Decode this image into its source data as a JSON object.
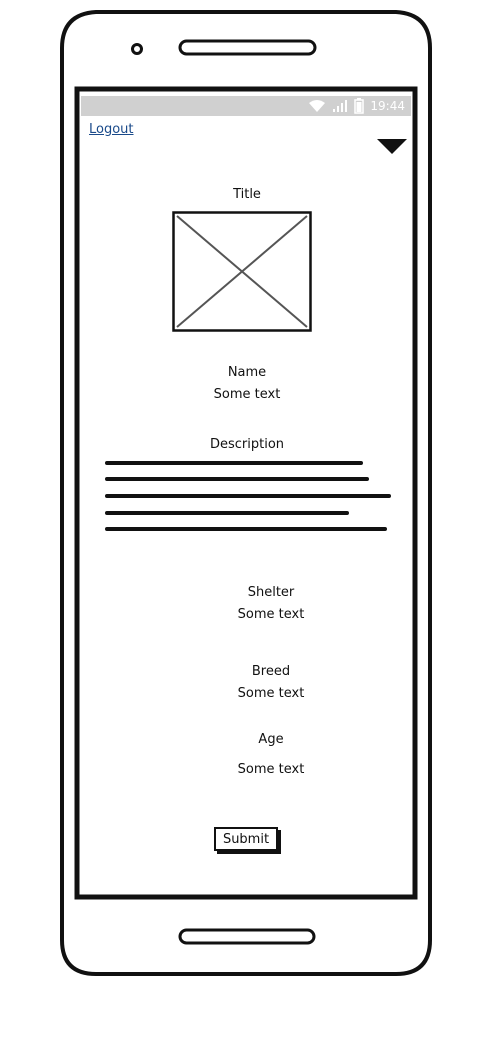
{
  "status_bar": {
    "time": "19:44"
  },
  "header": {
    "logout_label": "Logout"
  },
  "details": {
    "title_label": "Title",
    "name_label": "Name",
    "name_value": "Some text",
    "description_label": "Description",
    "shelter_label": "Shelter",
    "shelter_value": "Some text",
    "breed_label": "Breed",
    "breed_value": "Some text",
    "age_label": "Age",
    "age_value": "Some text"
  },
  "actions": {
    "submit_label": "Submit"
  },
  "icons": {
    "wifi": "wifi-icon",
    "signal": "signal-icon",
    "battery": "battery-icon",
    "menu": "dropdown-triangle-icon",
    "image": "image-placeholder-icon"
  },
  "colors": {
    "status_bar": "#d0d0d0",
    "link": "#1a4a8a",
    "ink": "#111111"
  }
}
